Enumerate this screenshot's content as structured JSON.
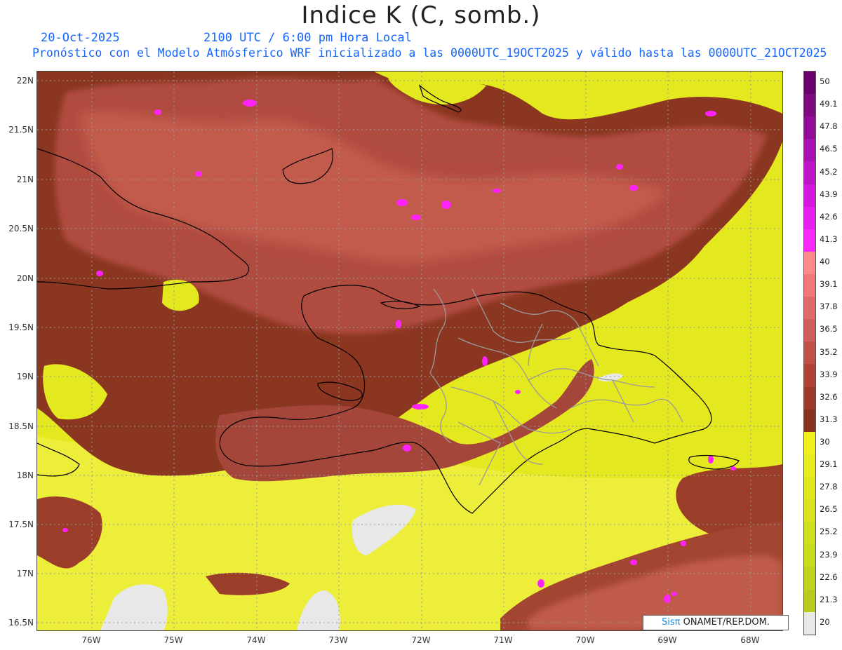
{
  "title": "Indice K (C, somb.)",
  "subtitle_date": "20-Oct-2025",
  "subtitle_time": "2100 UTC / 6:00 pm Hora Local",
  "subtitle_model": "Pronóstico con el Modelo Atmósferico WRF inicializado a las 0000UTC_19OCT2025 y válido hasta las  0000UTC_21OCT2025",
  "lat_labels": [
    "22N",
    "21.5N",
    "21N",
    "20.5N",
    "20N",
    "19.5N",
    "19N",
    "18.5N",
    "18N",
    "17.5N",
    "17N",
    "16.5N"
  ],
  "lon_labels": [
    "76W",
    "75W",
    "74W",
    "73W",
    "72W",
    "71W",
    "70W",
    "69W",
    "68W"
  ],
  "colorbar": {
    "labels": [
      "50",
      "49.1",
      "47.8",
      "46.5",
      "45.2",
      "43.9",
      "42.6",
      "41.3",
      "40",
      "39.1",
      "37.8",
      "36.5",
      "35.2",
      "33.9",
      "32.6",
      "31.3",
      "30",
      "29.1",
      "27.8",
      "26.5",
      "25.2",
      "23.9",
      "22.6",
      "21.3",
      "20"
    ],
    "colors": [
      "#6a006a",
      "#7e0a80",
      "#930c98",
      "#a812b0",
      "#bf14c8",
      "#d418dc",
      "#e81ef0",
      "#f828ff",
      "#ff8a8a",
      "#f27878",
      "#e06a6a",
      "#d05e5a",
      "#c0504a",
      "#ae4438",
      "#9c3a2c",
      "#8a3220",
      "#f0f01e",
      "#e8ec1e",
      "#e0e81e",
      "#d8e41e",
      "#d0e01e",
      "#c8dc1e",
      "#c0d41e",
      "#b8cc1e",
      "#e8e8e8"
    ]
  },
  "credit": {
    "brand": "Sisπ",
    "text": " ONAMET/REP.DOM."
  },
  "legend_colors": {
    "coast": "#000000",
    "provinces": "#9a9a9a",
    "grid": "#999999"
  }
}
